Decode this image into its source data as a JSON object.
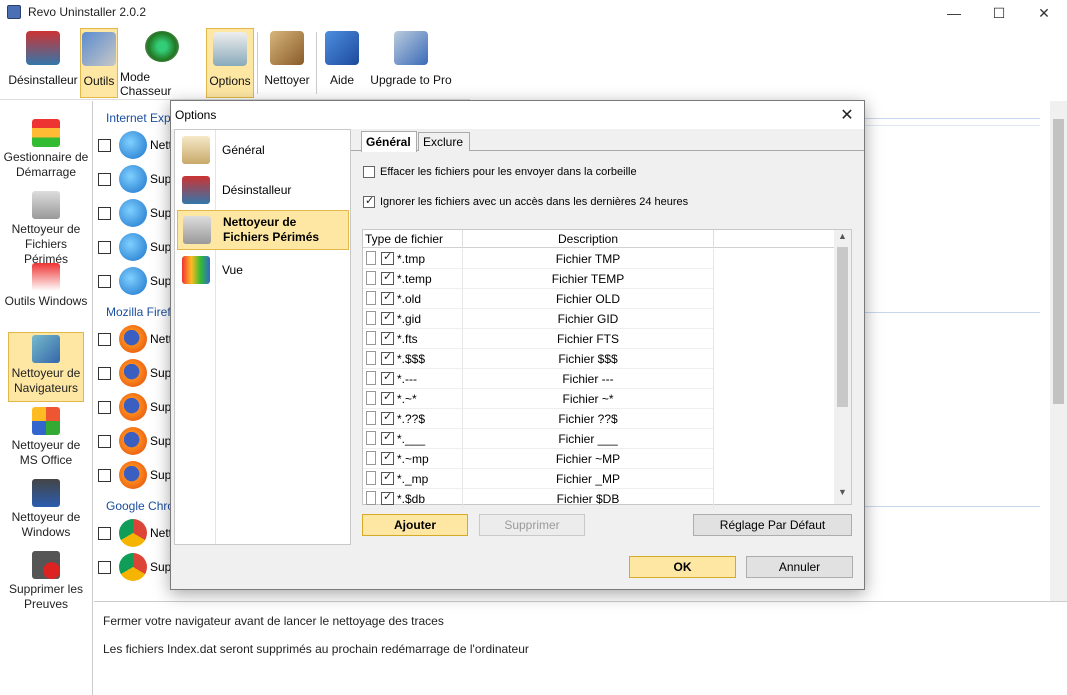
{
  "window": {
    "title": "Revo Uninstaller 2.0.2",
    "minimize": "—",
    "maximize": "☐",
    "close": "✕"
  },
  "toolbar": {
    "buttons": [
      {
        "label": "Désinstalleur",
        "icon": "uninstaller-icon"
      },
      {
        "label": "Outils",
        "icon": "tools-icon",
        "active": true
      },
      {
        "label": "Mode Chasseur",
        "icon": "hunter-mode-icon"
      },
      {
        "label": "Options",
        "icon": "options-icon",
        "active": true
      },
      {
        "label": "Nettoyer",
        "icon": "broom-icon"
      },
      {
        "label": "Aide",
        "icon": "help-book-icon"
      },
      {
        "label": "Upgrade to Pro",
        "icon": "upgrade-icon"
      }
    ]
  },
  "leftnav": {
    "items": [
      {
        "label": "Gestionnaire de Démarrage",
        "icon": "traffic-light-icon"
      },
      {
        "label": "Nettoyeur de Fichiers Périmés",
        "icon": "junk-files-icon"
      },
      {
        "label": "Outils Windows",
        "icon": "windows-tools-icon"
      },
      {
        "label": "Nettoyeur de Navigateurs",
        "icon": "browser-cleaner-icon",
        "active": true
      },
      {
        "label": "Nettoyeur de MS Office",
        "icon": "office-icon"
      },
      {
        "label": "Nettoyeur de Windows",
        "icon": "windows-icon"
      },
      {
        "label": "Supprimer les Preuves",
        "icon": "evidence-remover-icon"
      }
    ]
  },
  "main": {
    "groups": [
      {
        "name": "Internet Exp",
        "rows": [
          "Nett",
          "Supp",
          "Supp",
          "Supp",
          "Supp"
        ],
        "browser": "ie"
      },
      {
        "name": "Mozilla Firef",
        "rows": [
          "Nett",
          "Supp",
          "Supp",
          "Supp",
          "Supp"
        ],
        "browser": "ff"
      },
      {
        "name": "Google Chro",
        "rows": [
          "Nett",
          "Supp"
        ],
        "browser": "gc"
      }
    ]
  },
  "footer": {
    "line1": "Fermer votre navigateur avant de lancer le nettoyage des traces",
    "line2": "Les fichiers Index.dat seront supprimés au prochain redémarrage de l'ordinateur"
  },
  "dialog": {
    "title": "Options",
    "close": "✕",
    "nav": [
      {
        "label": "Général",
        "icon": "general-clipboard-icon"
      },
      {
        "label": "Désinstalleur",
        "icon": "uninstaller-icon"
      },
      {
        "label": "Nettoyeur de Fichiers Périmés",
        "icon": "junk-files-icon",
        "selected": true
      },
      {
        "label": "Vue",
        "icon": "view-icon"
      }
    ],
    "tabs": [
      "Général",
      "Exclure"
    ],
    "options": [
      {
        "label": "Effacer les fichiers pour les envoyer dans la corbeille",
        "checked": false
      },
      {
        "label": "Ignorer les fichiers avec un accès dans les dernières 24 heures",
        "checked": true
      }
    ],
    "table": {
      "headers": [
        "Type de fichier",
        "Description"
      ],
      "rows": [
        {
          "ext": "*.tmp",
          "desc": "Fichier TMP"
        },
        {
          "ext": "*.temp",
          "desc": "Fichier TEMP"
        },
        {
          "ext": "*.old",
          "desc": "Fichier OLD"
        },
        {
          "ext": "*.gid",
          "desc": "Fichier GID"
        },
        {
          "ext": "*.fts",
          "desc": "Fichier FTS"
        },
        {
          "ext": "*.$$$",
          "desc": "Fichier $$$"
        },
        {
          "ext": "*.---",
          "desc": "Fichier ---"
        },
        {
          "ext": "*.~*",
          "desc": "Fichier ~*"
        },
        {
          "ext": "*.??$",
          "desc": "Fichier ??$"
        },
        {
          "ext": "*.___",
          "desc": "Fichier ___"
        },
        {
          "ext": "*.~mp",
          "desc": "Fichier ~MP"
        },
        {
          "ext": "*._mp",
          "desc": "Fichier _MP"
        },
        {
          "ext": "*.$db",
          "desc": "Fichier $DB"
        }
      ]
    },
    "buttons": {
      "add": "Ajouter",
      "remove": "Supprimer",
      "default": "Réglage Par Défaut",
      "ok": "OK",
      "cancel": "Annuler"
    }
  }
}
